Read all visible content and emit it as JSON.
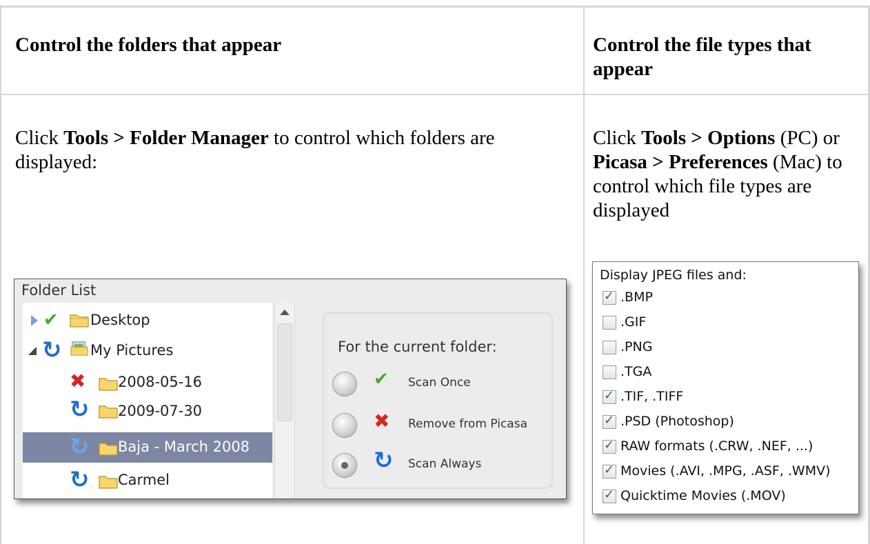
{
  "table": {
    "col1_header": "Control the folders that appear",
    "col2_header": "Control the file types that appear",
    "col1_body": {
      "pre": "Click ",
      "bold": "Tools > Folder Manager",
      "post": " to control which folders are displayed:"
    },
    "col2_body": {
      "pre": "Click ",
      "bold1": "Tools > Options",
      "mid1": " (PC) or ",
      "bold2": "Picasa > Preferences",
      "post": " (Mac) to control which file types are displayed"
    }
  },
  "folder_manager": {
    "title": "Folder List",
    "tree": [
      {
        "label": "Desktop",
        "status_icon": "check-icon",
        "expander": "collapsed"
      },
      {
        "label": "My Pictures",
        "status_icon": "refresh-icon",
        "expander": "expanded"
      },
      {
        "label": "2008-05-16",
        "status_icon": "x-icon"
      },
      {
        "label": "2009-07-30",
        "status_icon": "refresh-icon"
      },
      {
        "label": "Baja - March 2008",
        "status_icon": "refresh-icon",
        "selected": true
      },
      {
        "label": "Carmel",
        "status_icon": "refresh-icon"
      }
    ],
    "panel": {
      "header": "For the current folder:",
      "options": [
        {
          "label": "Scan Once",
          "icon": "check-icon",
          "selected": false
        },
        {
          "label": "Remove from Picasa",
          "icon": "x-icon",
          "selected": false
        },
        {
          "label": "Scan Always",
          "icon": "refresh-icon",
          "selected": true
        }
      ]
    }
  },
  "options_dialog": {
    "header": "Display JPEG files and:",
    "items": [
      {
        "label": ".BMP",
        "checked": true
      },
      {
        "label": ".GIF",
        "checked": false
      },
      {
        "label": ".PNG",
        "checked": false
      },
      {
        "label": ".TGA",
        "checked": false
      },
      {
        "label": ".TIF, .TIFF",
        "checked": true
      },
      {
        "label": ".PSD (Photoshop)",
        "checked": true
      },
      {
        "label": "RAW formats (.CRW, .NEF, ...)",
        "checked": true
      },
      {
        "label": "Movies (.AVI, .MPG, .ASF, .WMV)",
        "checked": true
      },
      {
        "label": "Quicktime Movies (.MOV)",
        "checked": true
      }
    ]
  },
  "colors": {
    "check": "#4aa829",
    "x": "#d42626",
    "refresh": "#1e6fd0",
    "selection": "#7d86a2"
  }
}
